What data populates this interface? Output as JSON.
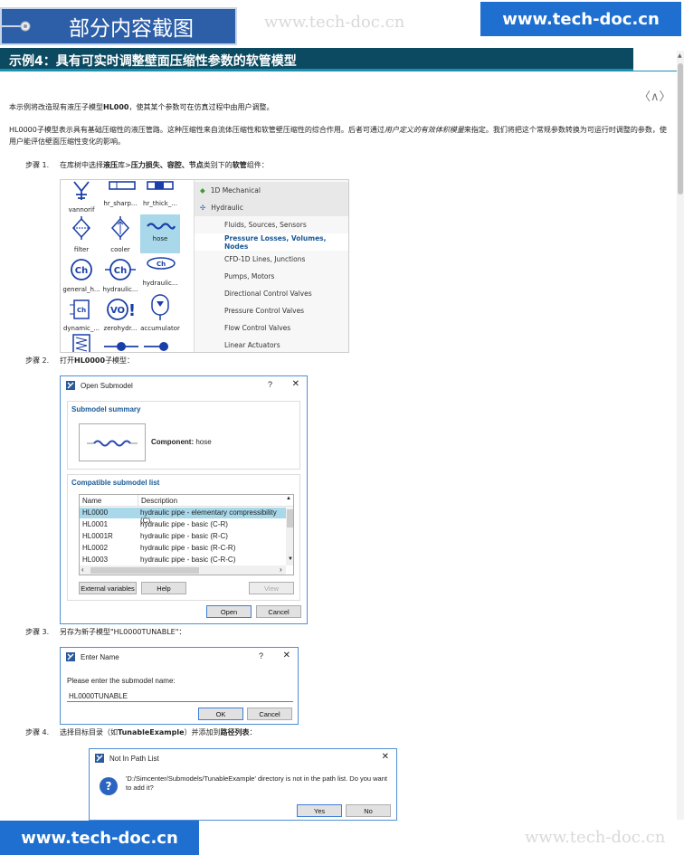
{
  "banner": {
    "title": "部分内容截图"
  },
  "watermark": {
    "top": "www.tech-doc.cn",
    "bottom": "www.tech-doc.cn"
  },
  "site": {
    "top": "www.tech-doc.cn",
    "bottom": "www.tech-doc.cn"
  },
  "page": {
    "title": "示例4：具有可实时调整壁面压缩性参数的软管模型",
    "nav": "〈∧〉",
    "intro_pre": "本示例将改造现有液压子模型",
    "intro_bold": "HL000",
    "intro_post": "，使其某个参数可在仿真过程中由用户调整。",
    "para2_pre": "HL0000子模型表示具有基础压缩性的液压管路。这种压缩性来自流体压缩性和软管壁压缩性的综合作用。后者可通过",
    "para2_italic": "用户定义的有效体积模量",
    "para2_post": "来指定。我们将把这个常规参数转换为可运行时调整的参数，使用户能评估壁面压缩性变化的影响。"
  },
  "steps": [
    {
      "label": "步骤 1.",
      "pre": "在库树中选择",
      "b1": "液压",
      "m1": "库>",
      "b2": "压力损失、容腔、节点",
      "m2": "类别下的",
      "b3": "软管",
      "post": "组件："
    },
    {
      "label": "步骤 2.",
      "pre": "打开",
      "b1": "HL0000",
      "post": "子模型："
    },
    {
      "label": "步骤 3.",
      "text": "另存为新子模型\"HL0000TUNABLE\"："
    },
    {
      "label": "步骤 4.",
      "pre": "选择目标目录（如",
      "b1": "TunableExample",
      "m1": "）并添加到",
      "b2": "路径列表",
      "post": "："
    }
  ],
  "library": {
    "components": [
      "vannorif",
      "hr_sharp...",
      "hr_thick_...",
      "filter",
      "cooler",
      "hose",
      "general_h...",
      "hydraulic...",
      "hydraulic...",
      "dynamic_...",
      "zerohydr...",
      "accumulator"
    ],
    "tree": [
      "1D Mechanical",
      "Hydraulic",
      "Fluids, Sources, Sensors",
      "Pressure Losses, Volumes, Nodes",
      "CFD-1D Lines, Junctions",
      "Pumps, Motors",
      "Directional Control Valves",
      "Pressure Control Valves",
      "Flow Control Valves",
      "Linear Actuators"
    ]
  },
  "open_submodel": {
    "title": "Open Submodel",
    "help_glyph": "?",
    "close_glyph": "✕",
    "summary_heading": "Submodel summary",
    "component_label": "Component:",
    "component_value": "hose",
    "list_heading": "Compatible submodel list",
    "columns": [
      "Name",
      "Description"
    ],
    "rows": [
      {
        "name": "HL0000",
        "desc": "hydraulic pipe - elementary compressibility (C)"
      },
      {
        "name": "HL0001",
        "desc": "hydraulic pipe - basic (C-R)"
      },
      {
        "name": "HL0001R",
        "desc": "hydraulic pipe - basic (R-C)"
      },
      {
        "name": "HL0002",
        "desc": "hydraulic pipe - basic (R-C-R)"
      },
      {
        "name": "HL0003",
        "desc": "hydraulic pipe - basic (C-R-C)"
      }
    ],
    "btn_external": "External variables",
    "btn_help": "Help",
    "btn_view": "View",
    "btn_open": "Open",
    "btn_cancel": "Cancel"
  },
  "enter_name": {
    "title": "Enter Name",
    "help_glyph": "?",
    "close_glyph": "✕",
    "prompt": "Please enter the submodel name:",
    "value": "HL0000TUNABLE",
    "btn_ok": "OK",
    "btn_cancel": "Cancel"
  },
  "not_in_path": {
    "title": "Not In Path List",
    "close_glyph": "✕",
    "message": "'D:/Simcenter/Submodels/TunableExample' directory is not in the path list. Do you want to add it?",
    "btn_yes": "Yes",
    "btn_no": "No"
  },
  "colors": {
    "banner": "#2d5fa8",
    "site": "#1e6fd0",
    "titlebar": "#0b4a60",
    "accent_line": "#1f8fb0",
    "dialog_heading": "#1a5a96",
    "selected_row": "#a8d8ea"
  }
}
